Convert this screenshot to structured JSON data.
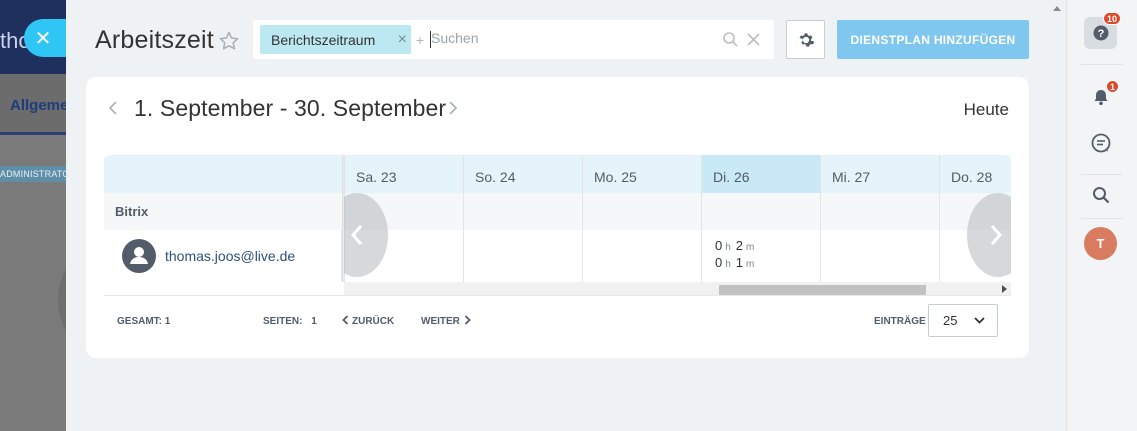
{
  "background": {
    "logo_text": "tho",
    "tab_label": "Allgeme",
    "admin_label": "ADMINISTRATO"
  },
  "slider": {
    "title": "Arbeitszeit",
    "filter": {
      "tag_label": "Berichtszeitraum",
      "add_symbol": "+",
      "search_placeholder": "Suchen"
    },
    "add_button_label": "DIENSTPLAN HINZUFÜGEN"
  },
  "calendar": {
    "period": "1. September - 30. September",
    "today_label": "Heute",
    "group_name": "Bitrix",
    "user_name": "thomas.joos@live.de",
    "days": [
      {
        "label": "Sa. 23",
        "today": false
      },
      {
        "label": "So. 24",
        "today": false
      },
      {
        "label": "Mo. 25",
        "today": false
      },
      {
        "label": "Di. 26",
        "today": true
      },
      {
        "label": "Mi. 27",
        "today": false
      },
      {
        "label": "Do. 28",
        "today": false
      }
    ],
    "entries_day": "Di. 26",
    "entries": [
      {
        "hours": "0",
        "hours_unit": "h",
        "minutes": "2",
        "minutes_unit": "m"
      },
      {
        "hours": "0",
        "hours_unit": "h",
        "minutes": "1",
        "minutes_unit": "m"
      }
    ]
  },
  "footer": {
    "total_label": "GESAMT: 1",
    "pages_label": "SEITEN:",
    "pages_value": "1",
    "back_label": "ZURÜCK",
    "next_label": "WEITER",
    "entries_label": "EINTRÄGE",
    "entries_value": "25"
  },
  "rail": {
    "help_badge": "10",
    "notifications_badge": "1",
    "user_initial": "T"
  },
  "colors": {
    "accent_button": "#7fc7ef",
    "filter_tag": "#bce8f1",
    "close_button": "#2fc6f6",
    "badge": "#e0482d",
    "user_avatar": "#d87b5f"
  }
}
